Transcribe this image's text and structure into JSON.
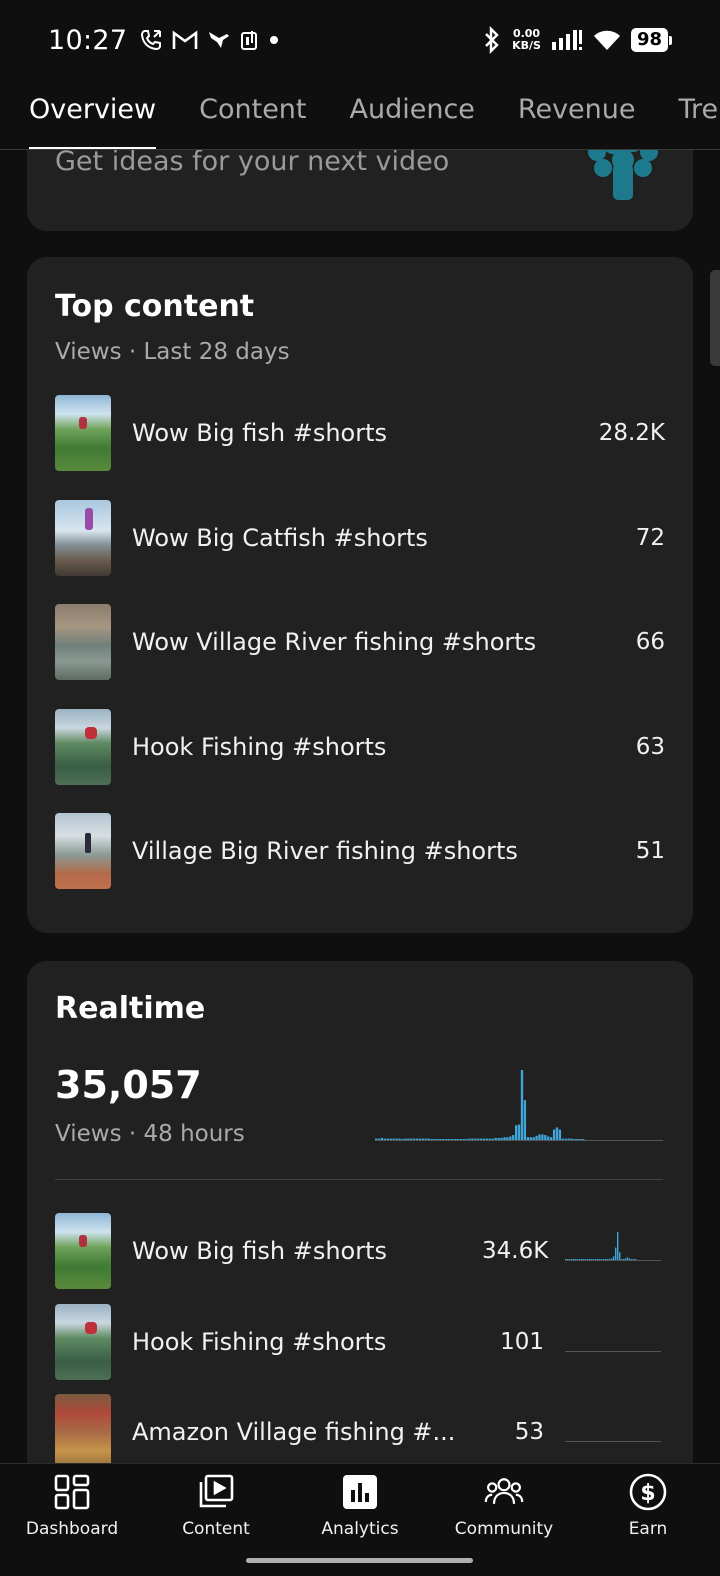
{
  "status_bar": {
    "time": "10:27",
    "net_speed_value": "0.00",
    "net_speed_unit": "KB/S",
    "battery": "98",
    "icons_left": [
      "call-icon",
      "gmail-icon",
      "hummingbird-icon",
      "nfc-icon",
      "dot-icon"
    ],
    "icons_right": [
      "bluetooth-icon",
      "signal-icon",
      "wifi-icon",
      "battery-icon"
    ]
  },
  "tabs": [
    {
      "label": "Overview",
      "active": true
    },
    {
      "label": "Content",
      "active": false
    },
    {
      "label": "Audience",
      "active": false
    },
    {
      "label": "Revenue",
      "active": false
    },
    {
      "label": "Trends",
      "active": false
    }
  ],
  "ideas_card": {
    "text": "Get ideas for your next video",
    "icon": "idea-plant-icon"
  },
  "top_content": {
    "title": "Top content",
    "subtitle": "Views · Last 28 days",
    "items": [
      {
        "title": "Wow Big fish #shorts",
        "value": "28.2K"
      },
      {
        "title": "Wow Big Catfish #shorts",
        "value": "72"
      },
      {
        "title": "Wow Village River fishing #shorts",
        "value": "66"
      },
      {
        "title": "Hook Fishing #shorts",
        "value": "63"
      },
      {
        "title": "Village Big River fishing #shorts",
        "value": "51"
      }
    ]
  },
  "realtime": {
    "title": "Realtime",
    "views": "35,057",
    "subtitle": "Views · 48 hours",
    "chart_data": {
      "type": "bar",
      "title": "",
      "xlabel": "",
      "ylabel": "",
      "values": [
        2,
        2,
        3,
        2,
        2,
        2,
        2,
        2,
        2,
        1,
        2,
        2,
        2,
        2,
        2,
        2,
        2,
        2,
        2,
        1,
        1,
        1,
        1,
        1,
        1,
        1,
        1,
        1,
        1,
        1,
        1,
        1,
        2,
        2,
        2,
        2,
        2,
        2,
        2,
        2,
        2,
        3,
        3,
        3,
        4,
        4,
        5,
        7,
        21,
        22,
        100,
        57,
        4,
        4,
        4,
        6,
        8,
        8,
        7,
        5,
        4,
        15,
        18,
        15,
        2,
        2,
        2,
        2,
        1,
        1,
        1,
        1
      ]
    },
    "items": [
      {
        "title": "Wow Big fish #shorts",
        "value": "34.6K",
        "spark": [
          1,
          1,
          1,
          1,
          1,
          1,
          1,
          1,
          1,
          1,
          1,
          1,
          1,
          1,
          1,
          1,
          1,
          1,
          2,
          2,
          3,
          3,
          4,
          5,
          12,
          40,
          90,
          25,
          3,
          3,
          6,
          8,
          5,
          2,
          2,
          2
        ]
      },
      {
        "title": "Hook Fishing #shorts",
        "value": "101",
        "spark": []
      },
      {
        "title": "Amazon Village fishing #...",
        "value": "53",
        "spark": []
      }
    ]
  },
  "bottom_nav": [
    {
      "label": "Dashboard",
      "icon": "dashboard-icon"
    },
    {
      "label": "Content",
      "icon": "content-icon"
    },
    {
      "label": "Analytics",
      "icon": "analytics-icon"
    },
    {
      "label": "Community",
      "icon": "community-icon"
    },
    {
      "label": "Earn",
      "icon": "earn-icon"
    }
  ]
}
